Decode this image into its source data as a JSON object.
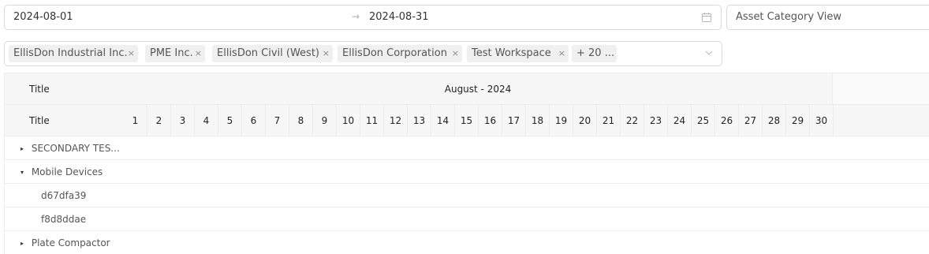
{
  "filters": {
    "date_start": "2024-08-01",
    "date_arrow": "→",
    "date_end": "2024-08-31",
    "view": "Asset Category View",
    "tags": [
      "EllisDon Industrial Inc.",
      "PME Inc.",
      "EllisDon Civil (West)",
      "EllisDon Corporation",
      "Test Workspace"
    ],
    "tag_remove": "×",
    "more_tags": "+ 20 ..."
  },
  "grid": {
    "header_title_1": "Title",
    "header_title_2": "Title",
    "month_label": "August - 2024",
    "days": [
      "1",
      "2",
      "3",
      "4",
      "5",
      "6",
      "7",
      "8",
      "9",
      "10",
      "11",
      "12",
      "13",
      "14",
      "15",
      "16",
      "17",
      "18",
      "19",
      "20",
      "21",
      "22",
      "23",
      "24",
      "25",
      "26",
      "27",
      "28",
      "29",
      "30"
    ],
    "rows": [
      {
        "label": "SECONDARY TES...",
        "toggle": "▸"
      },
      {
        "label": "Mobile Devices",
        "toggle": "▾"
      },
      {
        "label": "d67dfa39",
        "toggle": ""
      },
      {
        "label": "f8d8ddae",
        "toggle": ""
      },
      {
        "label": "Plate Compactor",
        "toggle": "▸"
      }
    ]
  },
  "icons": {
    "calendar": "calendar-icon",
    "chevron": "chevron-down-icon"
  }
}
